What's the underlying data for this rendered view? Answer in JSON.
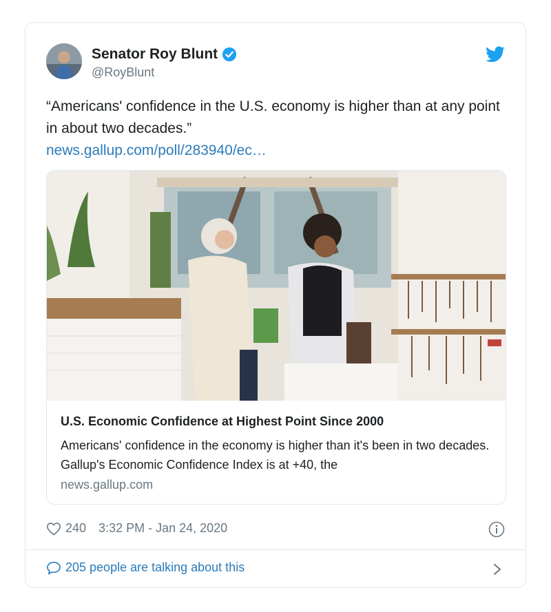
{
  "author": {
    "name": "Senator Roy Blunt",
    "handle": "@RoyBlunt"
  },
  "tweet": {
    "text": "“Americans' confidence in the U.S. economy is higher than at any point in about two decades.”",
    "link": "news.gallup.com/poll/283940/ec…"
  },
  "card": {
    "title": "U.S. Economic Confidence at Highest Point Since 2000",
    "description": "Americans' confidence in the economy is higher than it's been in two decades. Gallup's Economic Confidence Index is at +40, the",
    "domain": "news.gallup.com"
  },
  "meta": {
    "likes": "240",
    "timestamp": "3:32 PM - Jan 24, 2020"
  },
  "conversation": {
    "label": "205 people are talking about this"
  },
  "icons": {
    "verified": "verified-badge-icon",
    "brand": "twitter-bird-icon",
    "like": "heart-icon",
    "info": "info-icon",
    "reply": "speech-bubble-icon",
    "chevron": "chevron-right-icon"
  },
  "colors": {
    "link": "#2b7bb9",
    "twitter_blue": "#1da1f2",
    "muted": "#697882",
    "border": "#e1e8ed"
  }
}
